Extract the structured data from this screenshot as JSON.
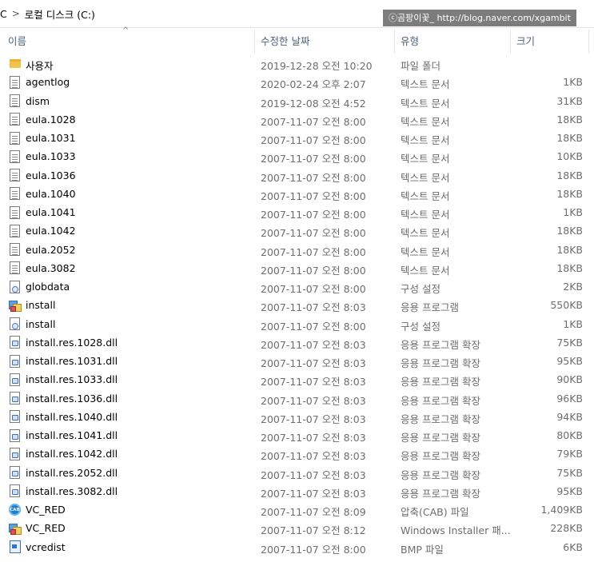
{
  "breadcrumb": {
    "root": "C",
    "separator": ">",
    "drive": "로컬 디스크 (C:)"
  },
  "watermark": "ⓒ곰팡이꽃_ http://blog.naver.com/xgambit",
  "columns": {
    "name": "이름",
    "date": "수정한 날짜",
    "type": "유형",
    "size": "크기"
  },
  "sort_indicator": "^",
  "files": [
    {
      "name": "사용자",
      "date": "2019-12-28 오전 10:20",
      "type": "파일 폴더",
      "size": "",
      "icon": "folder-icon"
    },
    {
      "name": "agentlog",
      "date": "2020-02-24 오후 2:07",
      "type": "텍스트 문서",
      "size": "1KB",
      "icon": "text-document-icon"
    },
    {
      "name": "dism",
      "date": "2019-12-08 오전 4:52",
      "type": "텍스트 문서",
      "size": "31KB",
      "icon": "text-document-icon"
    },
    {
      "name": "eula.1028",
      "date": "2007-11-07 오전 8:00",
      "type": "텍스트 문서",
      "size": "18KB",
      "icon": "text-document-icon"
    },
    {
      "name": "eula.1031",
      "date": "2007-11-07 오전 8:00",
      "type": "텍스트 문서",
      "size": "18KB",
      "icon": "text-document-icon"
    },
    {
      "name": "eula.1033",
      "date": "2007-11-07 오전 8:00",
      "type": "텍스트 문서",
      "size": "10KB",
      "icon": "text-document-icon"
    },
    {
      "name": "eula.1036",
      "date": "2007-11-07 오전 8:00",
      "type": "텍스트 문서",
      "size": "18KB",
      "icon": "text-document-icon"
    },
    {
      "name": "eula.1040",
      "date": "2007-11-07 오전 8:00",
      "type": "텍스트 문서",
      "size": "18KB",
      "icon": "text-document-icon"
    },
    {
      "name": "eula.1041",
      "date": "2007-11-07 오전 8:00",
      "type": "텍스트 문서",
      "size": "1KB",
      "icon": "text-document-icon"
    },
    {
      "name": "eula.1042",
      "date": "2007-11-07 오전 8:00",
      "type": "텍스트 문서",
      "size": "18KB",
      "icon": "text-document-icon"
    },
    {
      "name": "eula.2052",
      "date": "2007-11-07 오전 8:00",
      "type": "텍스트 문서",
      "size": "18KB",
      "icon": "text-document-icon"
    },
    {
      "name": "eula.3082",
      "date": "2007-11-07 오전 8:00",
      "type": "텍스트 문서",
      "size": "18KB",
      "icon": "text-document-icon"
    },
    {
      "name": "globdata",
      "date": "2007-11-07 오전 8:00",
      "type": "구성 설정",
      "size": "2KB",
      "icon": "config-settings-icon"
    },
    {
      "name": "install",
      "date": "2007-11-07 오전 8:03",
      "type": "응용 프로그램",
      "size": "550KB",
      "icon": "application-icon"
    },
    {
      "name": "install",
      "date": "2007-11-07 오전 8:00",
      "type": "구성 설정",
      "size": "1KB",
      "icon": "config-settings-icon"
    },
    {
      "name": "install.res.1028.dll",
      "date": "2007-11-07 오전 8:03",
      "type": "응용 프로그램 확장",
      "size": "75KB",
      "icon": "dll-icon"
    },
    {
      "name": "install.res.1031.dll",
      "date": "2007-11-07 오전 8:03",
      "type": "응용 프로그램 확장",
      "size": "95KB",
      "icon": "dll-icon"
    },
    {
      "name": "install.res.1033.dll",
      "date": "2007-11-07 오전 8:03",
      "type": "응용 프로그램 확장",
      "size": "90KB",
      "icon": "dll-icon"
    },
    {
      "name": "install.res.1036.dll",
      "date": "2007-11-07 오전 8:03",
      "type": "응용 프로그램 확장",
      "size": "96KB",
      "icon": "dll-icon"
    },
    {
      "name": "install.res.1040.dll",
      "date": "2007-11-07 오전 8:03",
      "type": "응용 프로그램 확장",
      "size": "94KB",
      "icon": "dll-icon"
    },
    {
      "name": "install.res.1041.dll",
      "date": "2007-11-07 오전 8:03",
      "type": "응용 프로그램 확장",
      "size": "80KB",
      "icon": "dll-icon"
    },
    {
      "name": "install.res.1042.dll",
      "date": "2007-11-07 오전 8:03",
      "type": "응용 프로그램 확장",
      "size": "79KB",
      "icon": "dll-icon"
    },
    {
      "name": "install.res.2052.dll",
      "date": "2007-11-07 오전 8:03",
      "type": "응용 프로그램 확장",
      "size": "75KB",
      "icon": "dll-icon"
    },
    {
      "name": "install.res.3082.dll",
      "date": "2007-11-07 오전 8:03",
      "type": "응용 프로그램 확장",
      "size": "95KB",
      "icon": "dll-icon"
    },
    {
      "name": "VC_RED",
      "date": "2007-11-07 오전 8:09",
      "type": "압축(CAB) 파일",
      "size": "1,409KB",
      "icon": "cab-archive-icon"
    },
    {
      "name": "VC_RED",
      "date": "2007-11-07 오전 8:12",
      "type": "Windows Installer 패...",
      "size": "228KB",
      "icon": "installer-icon"
    },
    {
      "name": "vcredist",
      "date": "2007-11-07 오전 8:00",
      "type": "BMP 파일",
      "size": "6KB",
      "icon": "bitmap-image-icon"
    }
  ]
}
